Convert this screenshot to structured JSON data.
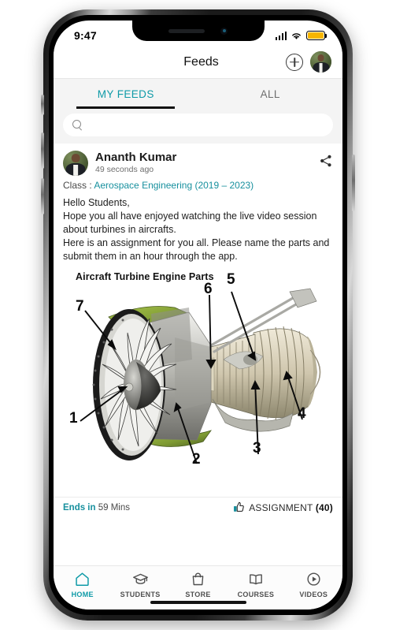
{
  "status_bar": {
    "time": "9:47",
    "signal_icon": "cellular-signal-icon",
    "wifi_icon": "wifi-icon",
    "battery_icon": "battery-icon",
    "battery_color": "#f7b500"
  },
  "header": {
    "title": "Feeds",
    "add_icon": "plus-circle-icon",
    "avatar_icon": "profile-avatar"
  },
  "tabs": [
    {
      "label": "MY FEEDS",
      "active": true
    },
    {
      "label": "ALL",
      "active": false
    }
  ],
  "search": {
    "value": "",
    "placeholder": "",
    "icon": "search-icon"
  },
  "post": {
    "author_name": "Ananth Kumar",
    "timestamp": "49 seconds ago",
    "share_icon": "share-icon",
    "class_label": "Class :",
    "class_name": "Aerospace Engineering (2019 – 2023)",
    "body": "Hello Students,\nHope you all have enjoyed watching the live video session about turbines in aircrafts.\nHere is an assignment for you all. Please name the parts and submit them in an hour through the app.",
    "footer": {
      "ends_label": "Ends in",
      "ends_value": "59 Mins",
      "like_icon": "thumbs-up-icon",
      "assignment_label": "ASSIGNMENT",
      "assignment_count": "(40)"
    }
  },
  "diagram": {
    "title": "Aircraft Turbine Engine Parts",
    "callouts": [
      "1",
      "2",
      "3",
      "4",
      "5",
      "6",
      "7"
    ]
  },
  "bottom_nav": [
    {
      "label": "HOME",
      "icon": "home-icon",
      "active": true
    },
    {
      "label": "STUDENTS",
      "icon": "graduation-cap-icon",
      "active": false
    },
    {
      "label": "STORE",
      "icon": "shopping-bag-icon",
      "active": false
    },
    {
      "label": "COURSES",
      "icon": "open-book-icon",
      "active": false
    },
    {
      "label": "VIDEOS",
      "icon": "play-circle-icon",
      "active": false
    }
  ],
  "theme": {
    "accent": "#0e9aa7",
    "link": "#17909e",
    "tab_bg": "#f4f4f4"
  }
}
